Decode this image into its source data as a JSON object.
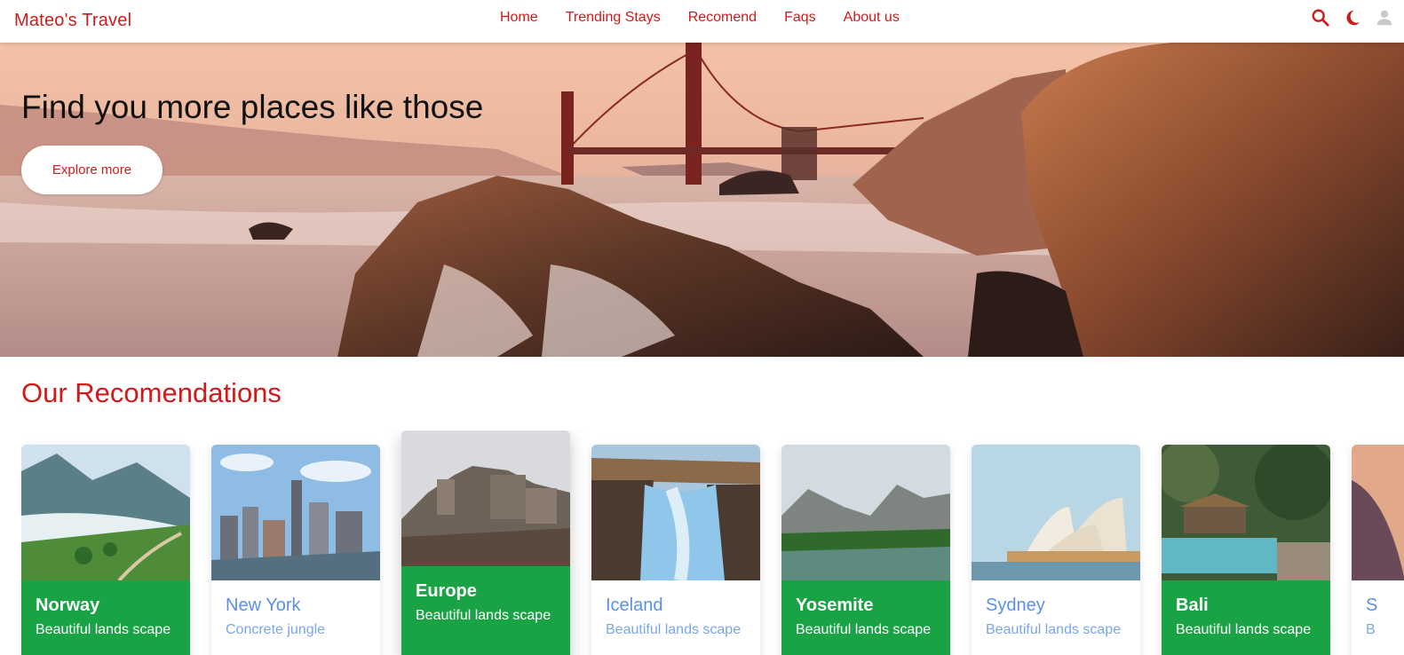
{
  "brand": "Mateo's Travel",
  "nav": {
    "links": [
      "Home",
      "Trending Stays",
      "Recomend",
      "Faqs",
      "About us"
    ],
    "icons": [
      "search-icon",
      "moon-icon",
      "user-icon"
    ]
  },
  "colors": {
    "accent": "#d11a1a",
    "card_green": "#1aa344",
    "card_blue_text": "#5b8fe8"
  },
  "hero": {
    "title": "Find you more places like those",
    "button": "Explore more"
  },
  "recommendations": {
    "title": "Our Recomendations",
    "cards": [
      {
        "name": "Norway",
        "desc": "Beautiful lands scape",
        "style": "green"
      },
      {
        "name": "New York",
        "desc": "Concrete jungle",
        "style": "white"
      },
      {
        "name": "Europe",
        "desc": "Beautiful lands scape",
        "style": "green"
      },
      {
        "name": "Iceland",
        "desc": "Beautiful lands scape",
        "style": "white"
      },
      {
        "name": "Yosemite",
        "desc": "Beautiful lands scape",
        "style": "green"
      },
      {
        "name": "Sydney",
        "desc": "Beautiful lands scape",
        "style": "white"
      },
      {
        "name": "Bali",
        "desc": "Beautiful lands scape",
        "style": "green"
      },
      {
        "name": "S",
        "desc": "B",
        "style": "white"
      }
    ]
  }
}
